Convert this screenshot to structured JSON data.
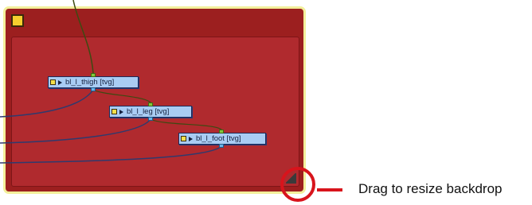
{
  "backdrop": {
    "color_icon": "color-swatch-icon",
    "background_color": "#9c1f1f",
    "border_color": "#f3ef9a",
    "resize_handle_icon": "resize-corner-icon"
  },
  "nodes": [
    {
      "label": "bl_l_thigh  [tvg]"
    },
    {
      "label": "bl_l_leg  [tvg]"
    },
    {
      "label": "bl_l_foot  [tvg]"
    }
  ],
  "callout": {
    "text": "Drag to resize backdrop",
    "color": "#d8141c"
  }
}
